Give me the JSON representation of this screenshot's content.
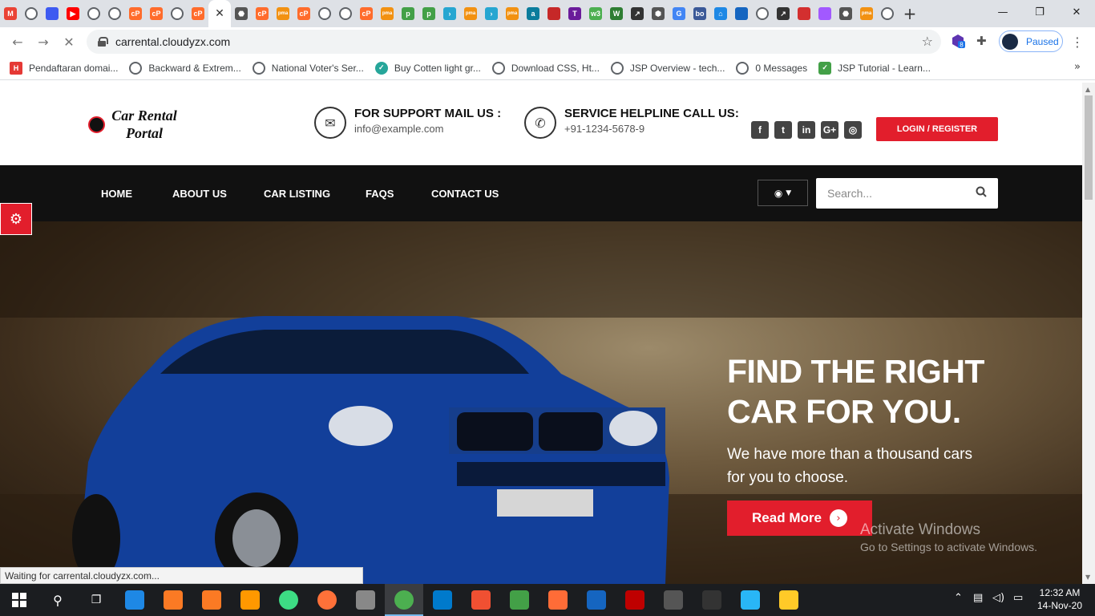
{
  "browser": {
    "tab_favicons": [
      {
        "name": "gmail-icon",
        "glyph": "M",
        "color": "#ea4335"
      },
      {
        "name": "globe-icon",
        "glyph": "",
        "color": "#5f6368"
      },
      {
        "name": "stripe-icon",
        "glyph": "",
        "color": "#3d5af1"
      },
      {
        "name": "youtube-icon",
        "glyph": "▶",
        "color": "#ff0000"
      },
      {
        "name": "globe-icon",
        "glyph": "",
        "color": "#5f6368"
      },
      {
        "name": "globe-icon",
        "glyph": "",
        "color": "#5f6368"
      },
      {
        "name": "cpanel-icon",
        "glyph": "cP",
        "color": "#ff6c2c"
      },
      {
        "name": "cpanel-icon",
        "glyph": "cP",
        "color": "#ff6c2c"
      },
      {
        "name": "globe-icon",
        "glyph": "",
        "color": "#5f6368"
      },
      {
        "name": "cpanel-icon",
        "glyph": "cP",
        "color": "#ff6c2c"
      }
    ],
    "tab_favicons_right": [
      {
        "name": "scroll-icon",
        "glyph": "⬣",
        "color": "#555"
      },
      {
        "name": "cpanel-icon",
        "glyph": "cP",
        "color": "#ff6c2c"
      },
      {
        "name": "phpmyadmin-icon",
        "glyph": "pma",
        "color": "#f29111"
      },
      {
        "name": "cpanel-icon",
        "glyph": "cP",
        "color": "#ff6c2c"
      },
      {
        "name": "globe-icon",
        "glyph": "",
        "color": "#5f6368"
      },
      {
        "name": "globe-icon",
        "glyph": "",
        "color": "#5f6368"
      },
      {
        "name": "cpanel-icon",
        "glyph": "cP",
        "color": "#ff6c2c"
      },
      {
        "name": "phpmyadmin-icon",
        "glyph": "pma",
        "color": "#f29111"
      },
      {
        "name": "p-green-icon",
        "glyph": "p",
        "color": "#43a047"
      },
      {
        "name": "p-green-icon",
        "glyph": "p",
        "color": "#43a047"
      },
      {
        "name": "chevron-teal-icon",
        "glyph": "›",
        "color": "#26a6d1"
      },
      {
        "name": "phpmyadmin-icon",
        "glyph": "pma",
        "color": "#f29111"
      },
      {
        "name": "chevron-teal-icon",
        "glyph": "›",
        "color": "#26a6d1"
      },
      {
        "name": "phpmyadmin-icon",
        "glyph": "pma",
        "color": "#f29111"
      },
      {
        "name": "a-teal-icon",
        "glyph": "a",
        "color": "#0b7c9c"
      },
      {
        "name": "cart-icon",
        "glyph": "",
        "color": "#c62828"
      },
      {
        "name": "t-purple-icon",
        "glyph": "T",
        "color": "#6a1b9a"
      },
      {
        "name": "w3-green-icon",
        "glyph": "w3",
        "color": "#4caf50"
      },
      {
        "name": "w3schools-icon",
        "glyph": "W",
        "color": "#2e7d32"
      },
      {
        "name": "arrow-icon",
        "glyph": "↗",
        "color": "#333"
      },
      {
        "name": "shield-icon",
        "glyph": "⬢",
        "color": "#555"
      },
      {
        "name": "google-icon",
        "glyph": "G",
        "color": "#4285f4"
      },
      {
        "name": "bo-icon",
        "glyph": "bo",
        "color": "#3b5998"
      },
      {
        "name": "home-icon",
        "glyph": "⌂",
        "color": "#1e88e5"
      },
      {
        "name": "cart-blue-icon",
        "glyph": "",
        "color": "#1565c0"
      },
      {
        "name": "globe-icon",
        "glyph": "",
        "color": "#5f6368"
      },
      {
        "name": "arrow-icon",
        "glyph": "↗",
        "color": "#333"
      },
      {
        "name": "red-circle-icon",
        "glyph": "",
        "color": "#d32f2f"
      },
      {
        "name": "figma-icon",
        "glyph": "",
        "color": "#a259ff"
      },
      {
        "name": "scroll-icon",
        "glyph": "⬣",
        "color": "#555"
      },
      {
        "name": "phpmyadmin-icon",
        "glyph": "pma",
        "color": "#f29111"
      },
      {
        "name": "globe-icon",
        "glyph": "",
        "color": "#5f6368"
      }
    ],
    "url": "carrental.cloudyzx.com",
    "profile_status": "Paused",
    "extension_badge": "8",
    "bookmarks": [
      {
        "label": "Pendaftaran domai...",
        "icon": "hostinger-icon",
        "color": "#e53935"
      },
      {
        "label": "Backward & Extrem...",
        "icon": "globe-icon",
        "color": "#5f6368"
      },
      {
        "label": "National Voter's Ser...",
        "icon": "globe-icon",
        "color": "#5f6368"
      },
      {
        "label": "Buy Cotten light gr...",
        "icon": "check-circle-icon",
        "color": "#26a69a"
      },
      {
        "label": "Download CSS, Ht...",
        "icon": "globe-icon",
        "color": "#5f6368"
      },
      {
        "label": "JSP Overview - tech...",
        "icon": "globe-icon",
        "color": "#5f6368"
      },
      {
        "label": "0 Messages",
        "icon": "globe-icon",
        "color": "#5f6368"
      },
      {
        "label": "JSP Tutorial - Learn...",
        "icon": "check-square-icon",
        "color": "#43a047"
      }
    ],
    "status_text": "Waiting for carrental.cloudyzx.com..."
  },
  "site": {
    "logo_line1": "Car Rental",
    "logo_line2": "Portal",
    "support_title": "FOR SUPPORT MAIL US :",
    "support_value": "info@example.com",
    "helpline_title": "SERVICE HELPLINE CALL US:",
    "helpline_value": "+91-1234-5678-9",
    "social": [
      {
        "name": "facebook-icon",
        "glyph": "f"
      },
      {
        "name": "twitter-icon",
        "glyph": "t"
      },
      {
        "name": "linkedin-icon",
        "glyph": "in"
      },
      {
        "name": "google-plus-icon",
        "glyph": "G+"
      },
      {
        "name": "instagram-icon",
        "glyph": "◎"
      }
    ],
    "login_label": "LOGIN / REGISTER",
    "nav": [
      "HOME",
      "ABOUT US",
      "CAR LISTING",
      "FAQS",
      "CONTACT US"
    ],
    "search_placeholder": "Search...",
    "brand_color": "#e21e2c",
    "hero_title_line1": "FIND THE RIGHT",
    "hero_title_line2": "CAR FOR YOU.",
    "hero_sub_line1": "We have more than a thousand cars",
    "hero_sub_line2": "for you to choose.",
    "read_more": "Read More",
    "activate_line1": "Activate Windows",
    "activate_line2": "Go to Settings to activate Windows."
  },
  "taskbar": {
    "apps": [
      {
        "name": "edge-icon",
        "color": "#1e88e5"
      },
      {
        "name": "xampp-icon",
        "color": "#fb7a24"
      },
      {
        "name": "xampp-icon",
        "color": "#fb7a24"
      },
      {
        "name": "sublime-icon",
        "color": "#ff9800"
      },
      {
        "name": "android-studio-icon",
        "color": "#3ddc84"
      },
      {
        "name": "firefox-icon",
        "color": "#ff7139"
      },
      {
        "name": "app-icon",
        "color": "#888"
      },
      {
        "name": "chrome-icon",
        "color": "#4caf50"
      },
      {
        "name": "vscode-icon",
        "color": "#007acc"
      },
      {
        "name": "git-icon",
        "color": "#f05032"
      },
      {
        "name": "cube-icon",
        "color": "#43a047"
      },
      {
        "name": "postman-icon",
        "color": "#ff6c37"
      },
      {
        "name": "network-icon",
        "color": "#1565c0"
      },
      {
        "name": "filezilla-icon",
        "color": "#bf0000"
      },
      {
        "name": "vm-icon",
        "color": "#555"
      },
      {
        "name": "terminal-icon",
        "color": "#333"
      },
      {
        "name": "paint-icon",
        "color": "#29b6f6"
      },
      {
        "name": "explorer-icon",
        "color": "#ffca28"
      }
    ],
    "time": "12:32 AM",
    "date": "14-Nov-20"
  }
}
